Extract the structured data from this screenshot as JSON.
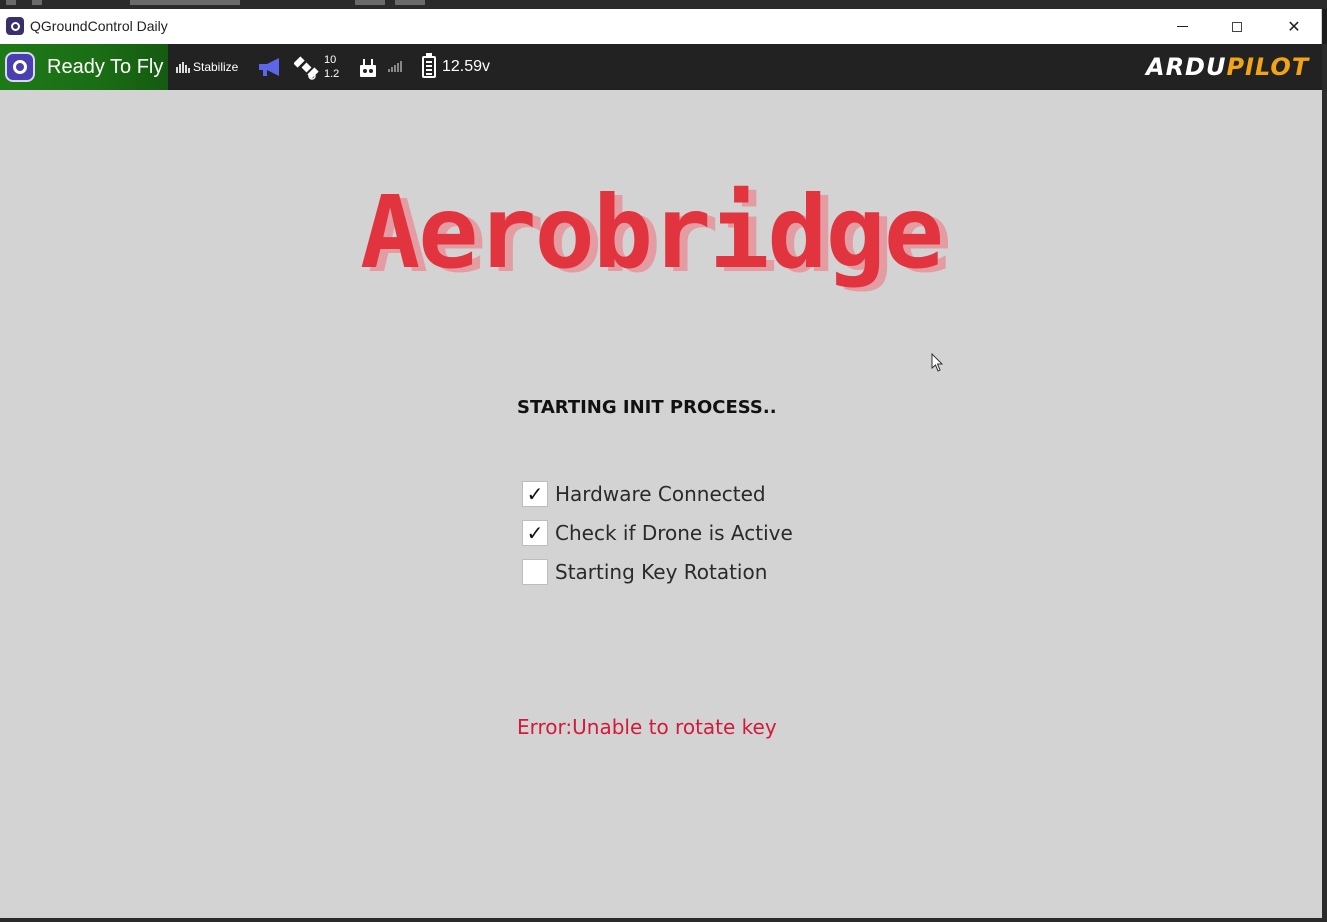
{
  "window": {
    "title": "QGroundControl Daily",
    "minimize_glyph": "",
    "close_glyph": "✕"
  },
  "toolbar": {
    "status": "Ready To Fly",
    "flight_mode": "Stabilize",
    "gps_sat_count": "10",
    "gps_hdop": "1.2",
    "battery_voltage": "12.59v",
    "logo_left": "ARDU",
    "logo_right": "PILOT",
    "colors": {
      "ready_bg": "#1e7a17",
      "megaphone": "#5b67e8",
      "logo_accent": "#f2a316"
    },
    "icons": [
      "qgc-logo-icon",
      "stabilize-mode-icon",
      "megaphone-icon",
      "gps-satellite-icon",
      "rc-controller-icon",
      "signal-strength-icon",
      "battery-icon"
    ]
  },
  "main": {
    "brand": "Aerobridge",
    "status_title": "STARTING INIT PROCESS..",
    "checklist": [
      {
        "label": "Hardware Connected",
        "checked": true,
        "mark": "✓"
      },
      {
        "label": "Check if Drone is Active",
        "checked": true,
        "mark": "✓"
      },
      {
        "label": "Starting Key Rotation",
        "checked": false,
        "mark": ""
      }
    ],
    "error": "Error:Unable to rotate key",
    "colors": {
      "brand": "#e2343f",
      "error": "#d21b3a",
      "background": "#d3d3d3"
    }
  }
}
